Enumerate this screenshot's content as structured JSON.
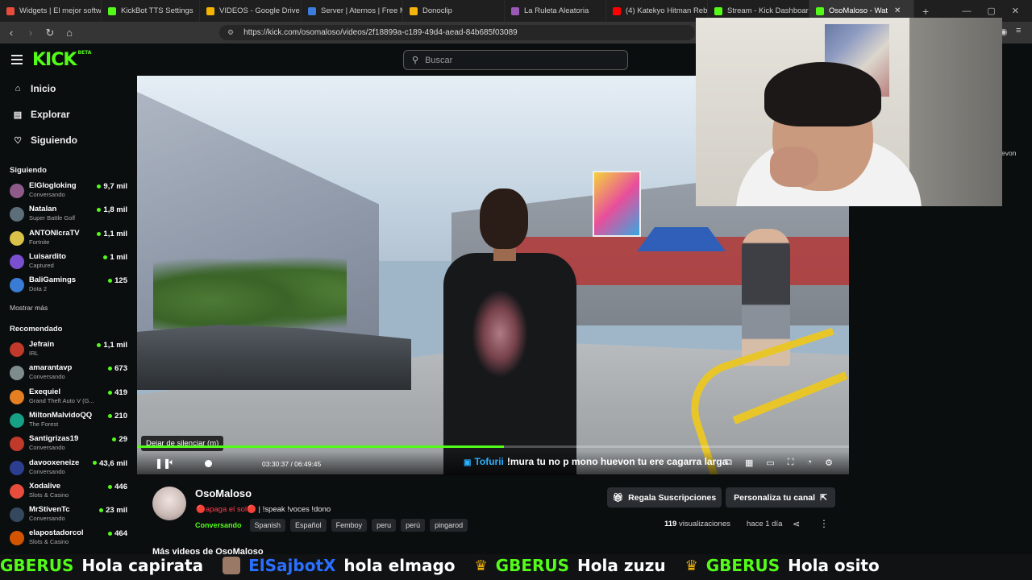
{
  "browser": {
    "tabs": [
      {
        "label": "Widgets | El mejor softwa",
        "color": "#e74c3c"
      },
      {
        "label": "KickBot TTS Settings",
        "color": "#53fc18"
      },
      {
        "label": "VIDEOS - Google Drive",
        "color": "#f4b400"
      },
      {
        "label": "Server | Aternos | Free Mi",
        "color": "#3b7ddd"
      },
      {
        "label": "Donoclip",
        "color": "#f5b50a"
      },
      {
        "label": "La Ruleta Aleatoria",
        "color": "#9b59b6"
      },
      {
        "label": "(4) Katekyo Hitman Rebo",
        "color": "#ff0000"
      },
      {
        "label": "Stream - Kick Dashboard",
        "color": "#53fc18"
      },
      {
        "label": "OsoMaloso - Wat",
        "color": "#53fc18",
        "active": true
      }
    ],
    "new_tab": "+",
    "url": "https://kick.com/osomaloso/videos/2f18899a-c189-49d4-aead-84b685f03089"
  },
  "header": {
    "logo": "KICK",
    "logo_badge": "BETA",
    "search_placeholder": "Buscar"
  },
  "sidebar": {
    "nav": [
      {
        "label": "Inicio",
        "icon": "home-icon"
      },
      {
        "label": "Explorar",
        "icon": "compass-icon"
      },
      {
        "label": "Siguiendo",
        "icon": "heart-icon"
      }
    ],
    "following_title": "Siguiendo",
    "following": [
      {
        "name": "ElGlogloking",
        "category": "Conversando",
        "viewers": "9,7 mil",
        "color": "#8e5a8a"
      },
      {
        "name": "Natalan",
        "category": "Super Battle Golf",
        "viewers": "1,8 mil",
        "color": "#5c6e7a"
      },
      {
        "name": "ANTONIcraTV",
        "category": "Fortnite",
        "viewers": "1,1 mil",
        "color": "#d9c24a"
      },
      {
        "name": "Luisardito",
        "category": "Captured",
        "viewers": "1 mil",
        "color": "#7a4fd0"
      },
      {
        "name": "BaliGamings",
        "category": "Dota 2",
        "viewers": "125",
        "color": "#3a7bd5"
      }
    ],
    "show_more": "Mostrar más",
    "recommended_title": "Recomendado",
    "recommended": [
      {
        "name": "Jefrain",
        "category": "IRL",
        "viewers": "1,1 mil",
        "color": "#c0392b"
      },
      {
        "name": "amarantavp",
        "category": "Conversando",
        "viewers": "673",
        "color": "#7f8c8d"
      },
      {
        "name": "Exequiel",
        "category": "Grand Theft Auto V (G...",
        "viewers": "419",
        "color": "#e67e22"
      },
      {
        "name": "MiltonMalvidoQQ",
        "category": "The Forest",
        "viewers": "210",
        "color": "#16a085"
      },
      {
        "name": "Santigrizas19",
        "category": "Conversando",
        "viewers": "29",
        "color": "#c0392b"
      },
      {
        "name": "davooxeneize",
        "category": "Conversando",
        "viewers": "43,6 mil",
        "color": "#2c3e90"
      },
      {
        "name": "Xodalive",
        "category": "Slots & Casino",
        "viewers": "446",
        "color": "#e74c3c"
      },
      {
        "name": "MrStivenTc",
        "category": "Conversando",
        "viewers": "23 mil",
        "color": "#34495e"
      },
      {
        "name": "elapostadorcol",
        "category": "Slots & Casino",
        "viewers": "464",
        "color": "#d35400"
      }
    ]
  },
  "player": {
    "tooltip": "Dejar de silenciar (m)",
    "time": "03:30:37 / 06:49:45",
    "progress": 0.515,
    "chat_overlay": {
      "badge": "▣",
      "user": "Tofurii",
      "message": "!mura tu no p mono huevon tu ere cagarra larga"
    }
  },
  "channel": {
    "name": "OsoMaloso",
    "title_prefix": "🔴apaga el sol🔴",
    "title_rest": " | !speak !voces !dono",
    "category": "Conversando",
    "tags": [
      "Spanish",
      "Español",
      "Femboy",
      "peru",
      "perú",
      "pingarod"
    ],
    "subs_button": "Regala Suscripciones",
    "custom_button": "Personaliza tu canal",
    "views_count": "119",
    "views_label": "visualizaciones",
    "ago": "hace 1 día",
    "more_videos": "Más videos de OsoMaloso"
  },
  "right_fragment": "evon",
  "ticker": [
    {
      "user": "GBERUS",
      "message": "Hola capirata"
    },
    {
      "user": "ElSajbotX",
      "message": "hola elmago",
      "blue": true
    },
    {
      "user": "GBERUS",
      "message": "Hola zuzu"
    },
    {
      "user": "GBERUS",
      "message": "Hola osito"
    }
  ],
  "colors": {
    "accent": "#53fc18",
    "background": "#0b0e0f"
  }
}
